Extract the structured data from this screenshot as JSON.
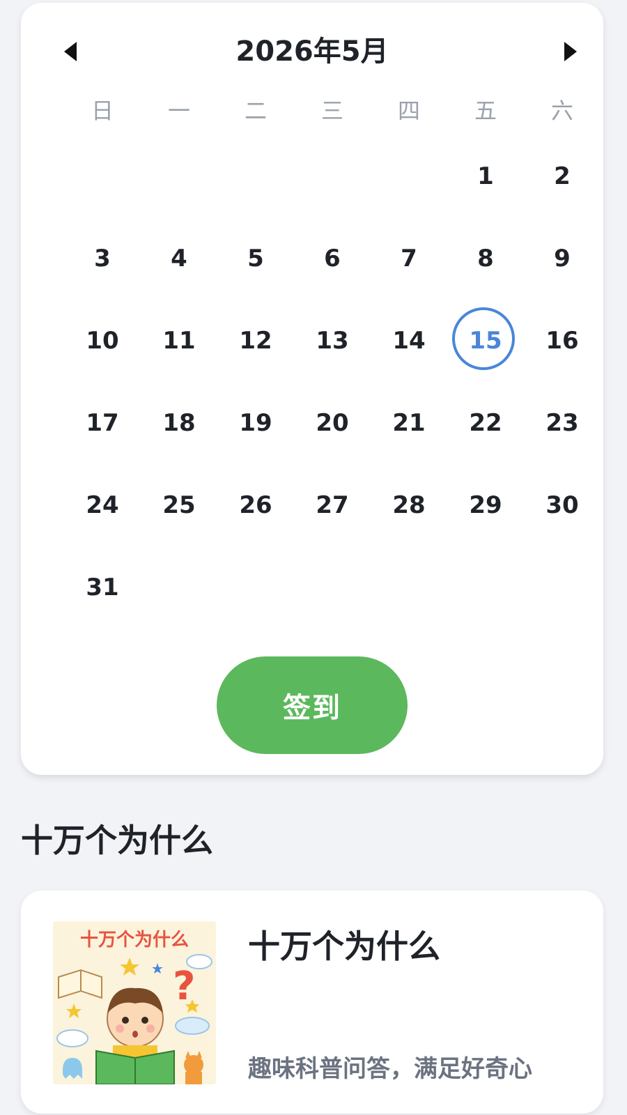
{
  "calendar": {
    "month_title": "2026年5月",
    "prev_icon": "caret-left-icon",
    "next_icon": "caret-right-icon",
    "weekdays": [
      "日",
      "一",
      "二",
      "三",
      "四",
      "五",
      "六"
    ],
    "weeks": [
      [
        "",
        "",
        "",
        "",
        "",
        "1",
        "2"
      ],
      [
        "3",
        "4",
        "5",
        "6",
        "7",
        "8",
        "9"
      ],
      [
        "10",
        "11",
        "12",
        "13",
        "14",
        "15",
        "16"
      ],
      [
        "17",
        "18",
        "19",
        "20",
        "21",
        "22",
        "23"
      ],
      [
        "24",
        "25",
        "26",
        "27",
        "28",
        "29",
        "30"
      ],
      [
        "31",
        "",
        "",
        "",
        "",
        "",
        ""
      ]
    ],
    "selected_day": "15",
    "selected_color": "#4a86d9",
    "checkin_label": "签到",
    "checkin_color": "#5cb85c"
  },
  "section": {
    "title": "十万个为什么"
  },
  "book": {
    "cover_text": "十万个为什么",
    "title": "十万个为什么",
    "description": "趣味科普问答，满足好奇心"
  }
}
